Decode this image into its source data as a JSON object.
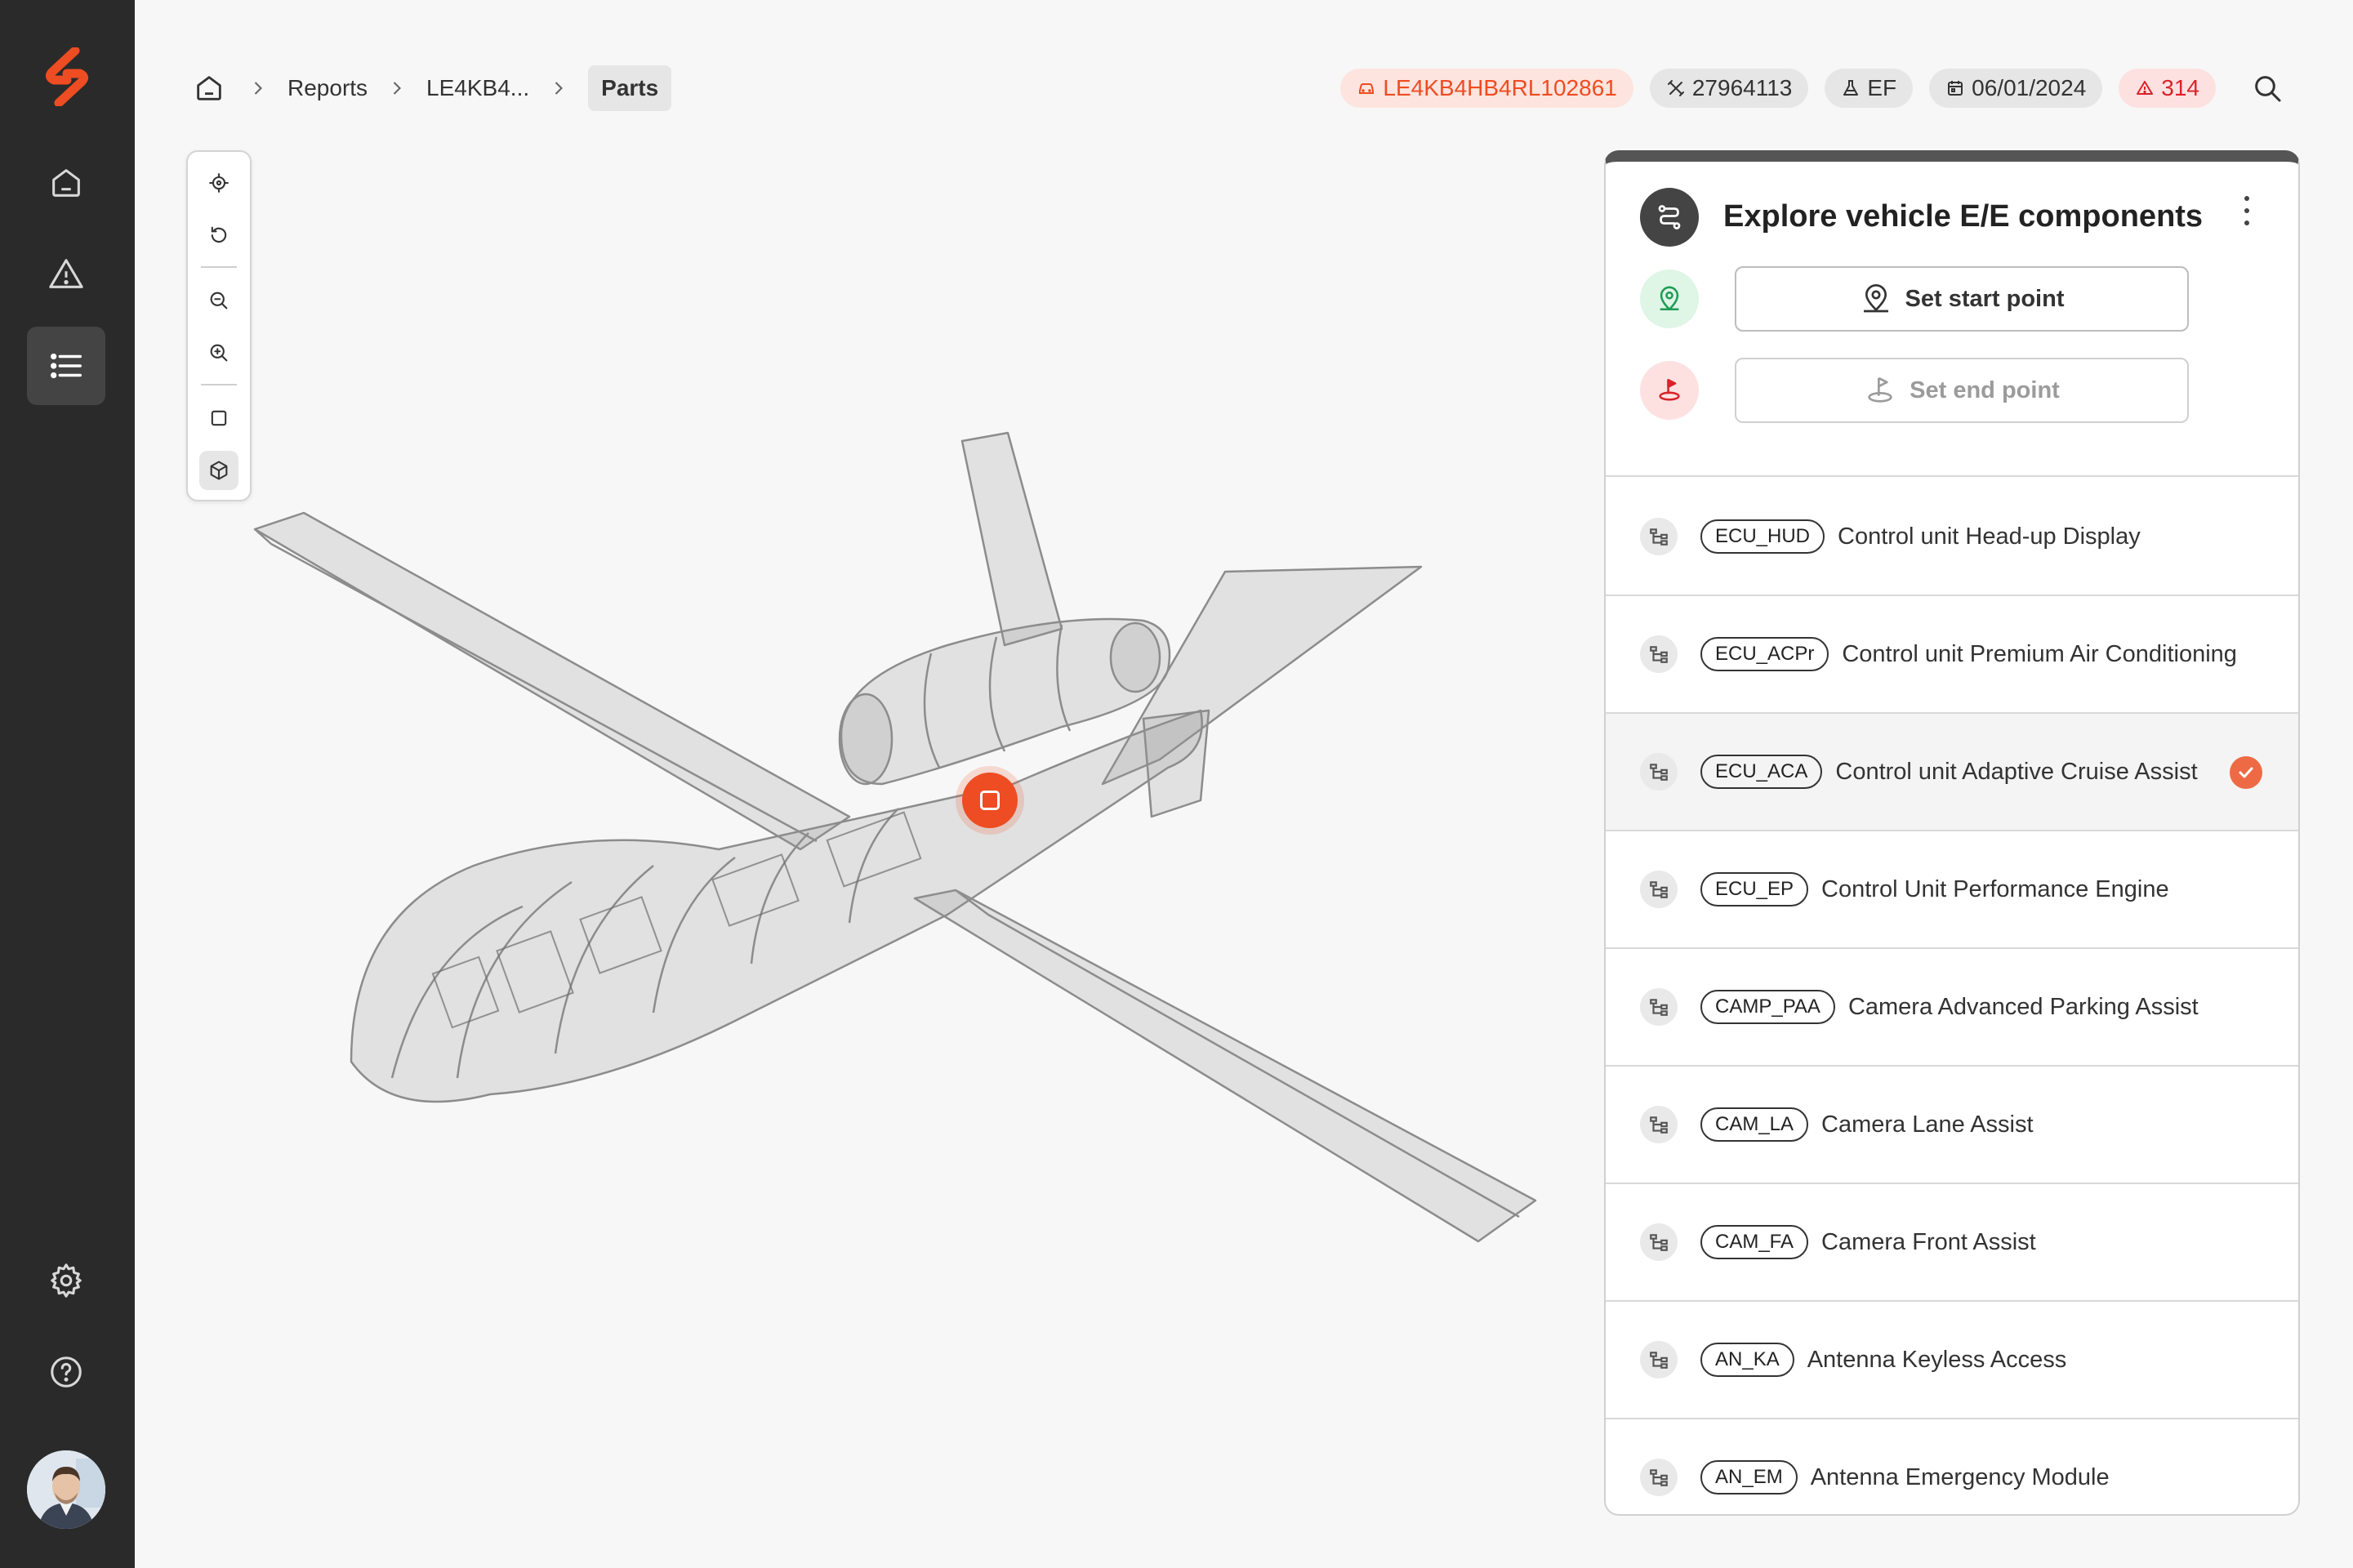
{
  "breadcrumb": {
    "items": [
      "Reports",
      "LE4KB4..."
    ],
    "current": "Parts"
  },
  "chips": [
    {
      "icon": "car-icon",
      "label": "LE4KB4HB4RL102861",
      "style": "orange"
    },
    {
      "icon": "tools-icon",
      "label": "27964113",
      "style": "default"
    },
    {
      "icon": "flask-icon",
      "label": "EF",
      "style": "default"
    },
    {
      "icon": "calendar-icon",
      "label": "06/01/2024",
      "style": "default"
    },
    {
      "icon": "warning-icon",
      "label": "314",
      "style": "red"
    }
  ],
  "panel": {
    "title": "Explore vehicle E/E components",
    "start_label": "Set start point",
    "end_label": "Set end point"
  },
  "components": [
    {
      "code": "ECU_HUD",
      "name": "Control unit Head-up Display",
      "selected": false
    },
    {
      "code": "ECU_ACPr",
      "name": "Control unit Premium Air Conditioning",
      "selected": false
    },
    {
      "code": "ECU_ACA",
      "name": "Control unit Adaptive Cruise Assist",
      "selected": true
    },
    {
      "code": "ECU_EP",
      "name": "Control Unit Performance Engine",
      "selected": false
    },
    {
      "code": "CAMP_PAA",
      "name": "Camera Advanced Parking Assist",
      "selected": false
    },
    {
      "code": "CAM_LA",
      "name": "Camera Lane Assist",
      "selected": false
    },
    {
      "code": "CAM_FA",
      "name": "Camera Front Assist",
      "selected": false
    },
    {
      "code": "AN_KA",
      "name": "Antenna Keyless Access",
      "selected": false
    },
    {
      "code": "AN_EM",
      "name": "Antenna Emergency Module",
      "selected": false
    }
  ],
  "colors": {
    "accent": "#ee4c22",
    "sidebar": "#2a2a2a",
    "alert": "#d8232a"
  }
}
